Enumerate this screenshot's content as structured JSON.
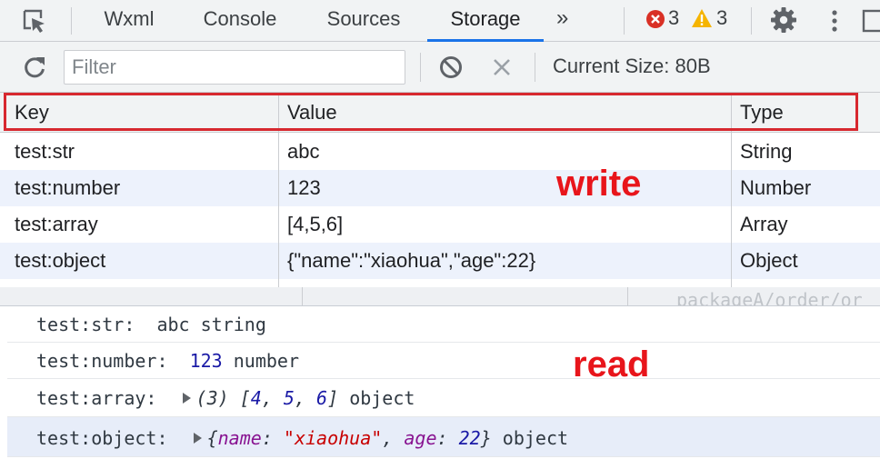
{
  "tabs": [
    {
      "label": "Wxml",
      "active": false
    },
    {
      "label": "Console",
      "active": false
    },
    {
      "label": "Sources",
      "active": false
    },
    {
      "label": "Storage",
      "active": true
    }
  ],
  "more_tabs_glyph": "»",
  "icons": {
    "inspect": "inspect-element-icon",
    "error": "error-icon",
    "warning": "warning-icon",
    "settings": "gear-icon",
    "menu": "kebab-menu-icon",
    "refresh": "refresh-icon",
    "clear": "clear-all-icon",
    "delete": "delete-selected-icon"
  },
  "counts": {
    "errors": "3",
    "warnings": "3"
  },
  "colors": {
    "accent": "#1a73e8",
    "error": "#d93025",
    "warning": "#f5b400",
    "annotation": "#e8151b"
  },
  "toolbar": {
    "filter_placeholder": "Filter",
    "filter_value": "",
    "current_size": "Current Size: 80B"
  },
  "table": {
    "columns": [
      "Key",
      "Value",
      "Type"
    ],
    "rows": [
      {
        "key": "test:str",
        "value": "abc",
        "type": "String"
      },
      {
        "key": "test:number",
        "value": "123",
        "type": "Number"
      },
      {
        "key": "test:array",
        "value": "[4,5,6]",
        "type": "Array"
      },
      {
        "key": "test:object",
        "value": "{\"name\":\"xiaohua\",\"age\":22}",
        "type": "Object"
      }
    ]
  },
  "annotations": {
    "write": "write",
    "read": "read"
  },
  "console": {
    "background_path": "packageA/order/or",
    "rows": [
      {
        "label": "test:str:",
        "value": "abc",
        "type": "string"
      },
      {
        "label": "test:number:",
        "value": "123",
        "type": "number"
      },
      {
        "label": "test:array:",
        "count": "(3)",
        "open": "[",
        "items": [
          "4",
          "5",
          "6"
        ],
        "close": "]",
        "type": "object"
      },
      {
        "label": "test:object:",
        "open": "{",
        "k1": "name",
        "v1": "\"xiaohua\"",
        "k2": "age",
        "v2": "22",
        "close": "}",
        "type": "object"
      }
    ]
  }
}
